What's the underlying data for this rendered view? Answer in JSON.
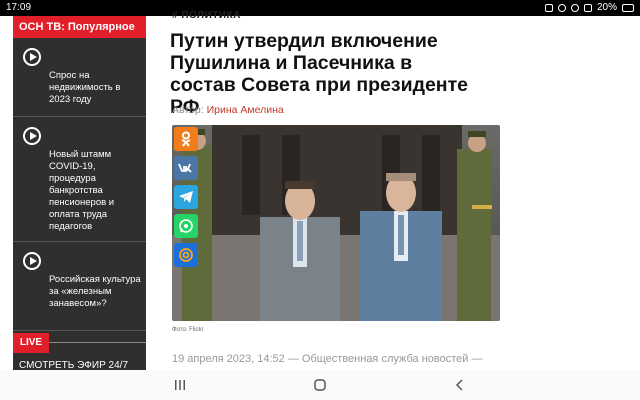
{
  "status_bar": {
    "time": "17:09",
    "battery": "20%"
  },
  "sidebar": {
    "header": "ОСН ТВ: Популярное",
    "items": [
      {
        "text": "Спрос на недвижимость в 2023 году"
      },
      {
        "text": "Новый штамм COVID-19, процедура банкротства пенсионеров и оплата труда педагогов"
      },
      {
        "text": "Российская культура за «железным занавесом»?"
      }
    ],
    "live_label": "LIVE",
    "watch_label": "СМОТРЕТЬ ЭФИР 24/7"
  },
  "article": {
    "tag": "# ПОЛИТИКА",
    "title": "Путин утвердил включение Пушилина и Пасечника в состав Совета при президенте РФ",
    "author_label": "Автор:",
    "author_name": "Ирина Амелина",
    "photo_credit": "Фото: Flickr",
    "meta": "19 апреля 2023, 14:52 — Общественная служба новостей —"
  },
  "share": [
    {
      "name": "odnoklassniki",
      "color": "#f07d1a"
    },
    {
      "name": "vkontakte",
      "color": "#4a76a8"
    },
    {
      "name": "telegram",
      "color": "#2ca5e0"
    },
    {
      "name": "whatsapp",
      "color": "#25d366"
    },
    {
      "name": "mail",
      "color": "#1c6fd6"
    }
  ]
}
